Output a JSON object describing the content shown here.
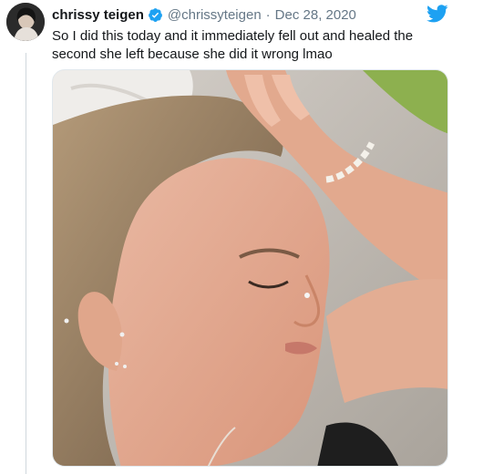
{
  "tweet": {
    "author_name": "chrissy teigen",
    "handle": "@chrissyteigen",
    "separator": "·",
    "date": "Dec 28, 2020",
    "text": "So I did this today and it immediately fell out and healed the second she left because she did it wrong lmao"
  },
  "icons": {
    "avatar": "profile-avatar",
    "verified": "verified-badge-icon",
    "brand": "twitter-bird-icon"
  },
  "colors": {
    "brand": "#1da1f2",
    "name": "#14171a",
    "muted": "#657786"
  }
}
